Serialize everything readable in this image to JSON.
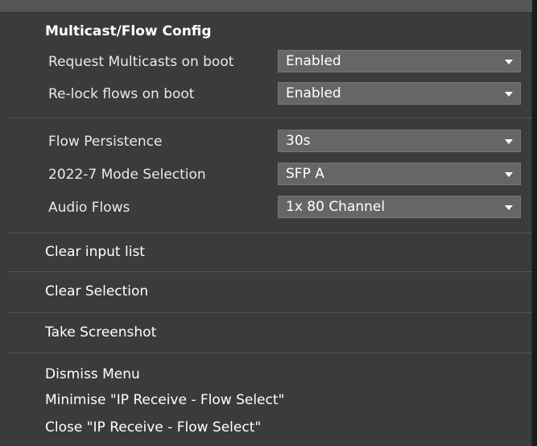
{
  "menu": {
    "section_title": "Multicast/Flow Config",
    "request_multicasts": {
      "label": "Request Multicasts on boot",
      "value": "Enabled"
    },
    "relock_flows": {
      "label": "Re-lock flows on boot",
      "value": "Enabled"
    },
    "flow_persistence": {
      "label": "Flow Persistence",
      "value": "30s"
    },
    "mode_selection": {
      "label": "2022-7 Mode Selection",
      "value": "SFP A"
    },
    "audio_flows": {
      "label": "Audio Flows",
      "value": "1x 80 Channel"
    },
    "clear_input_list": "Clear input list",
    "clear_selection": "Clear Selection",
    "take_screenshot": "Take Screenshot",
    "dismiss_menu": "Dismiss Menu",
    "minimise": "Minimise \"IP Receive - Flow Select\"",
    "close": "Close \"IP Receive - Flow Select\""
  },
  "icons": {
    "dropdown": "chevron-down-icon"
  },
  "colors": {
    "menu_bg": "#3b3b3b",
    "dropdown_bg": "#666666",
    "text": "#ffffff"
  }
}
